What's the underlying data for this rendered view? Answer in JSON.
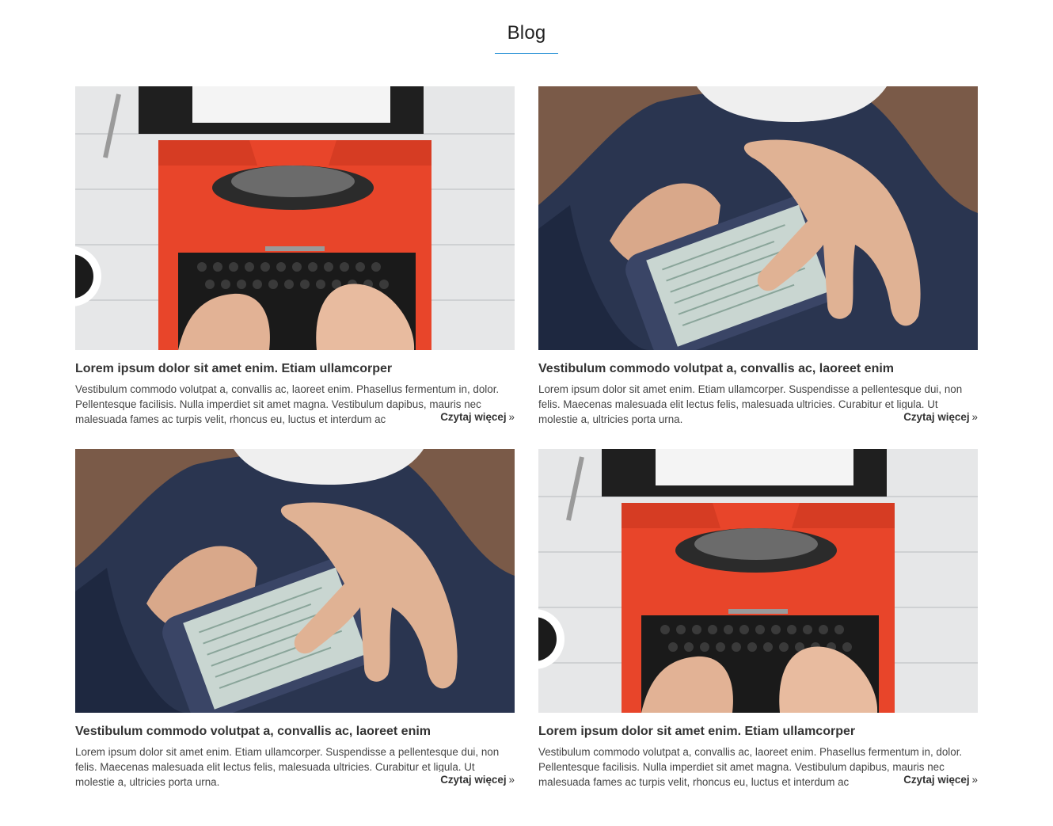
{
  "header": {
    "title": "Blog"
  },
  "posts": [
    {
      "image": "typewriter",
      "title": "Lorem ipsum dolor sit amet enim. Etiam ullamcorper",
      "excerpt": "Vestibulum commodo volutpat a, convallis ac, laoreet enim. Phasellus fermentum in, dolor. Pellentesque facilisis. Nulla imperdiet sit amet magna. Vestibulum dapibus, mauris nec malesuada fames ac turpis velit, rhoncus eu, luctus et interdum ac",
      "read_more": "Czytaj więcej",
      "read_more_icon": "»"
    },
    {
      "image": "smartphone",
      "title": "Vestibulum commodo volutpat a, convallis ac, laoreet enim",
      "excerpt": "Lorem ipsum dolor sit amet enim. Etiam ullamcorper. Suspendisse a pellentesque dui, non felis. Maecenas malesuada elit lectus felis, malesuada ultricies. Curabitur et ligula. Ut molestie a, ultricies porta urna.",
      "read_more": "Czytaj więcej",
      "read_more_icon": "»"
    },
    {
      "image": "smartphone",
      "title": "Vestibulum commodo volutpat a, convallis ac, laoreet enim",
      "excerpt": "Lorem ipsum dolor sit amet enim. Etiam ullamcorper. Suspendisse a pellentesque dui, non felis. Maecenas malesuada elit lectus felis, malesuada ultricies. Curabitur et ligula. Ut molestie a, ultricies porta urna.",
      "read_more": "Czytaj więcej",
      "read_more_icon": "»"
    },
    {
      "image": "typewriter",
      "title": "Lorem ipsum dolor sit amet enim. Etiam ullamcorper",
      "excerpt": "Vestibulum commodo volutpat a, convallis ac, laoreet enim. Phasellus fermentum in, dolor. Pellentesque facilisis. Nulla imperdiet sit amet magna. Vestibulum dapibus, mauris nec malesuada fames ac turpis velit, rhoncus eu, luctus et interdum ac",
      "read_more": "Czytaj więcej",
      "read_more_icon": "»"
    }
  ],
  "colors": {
    "accent": "#3a9ad9",
    "typewriter": "#e8452a",
    "denim": "#2a3550",
    "sweater": "#7a5a48"
  }
}
